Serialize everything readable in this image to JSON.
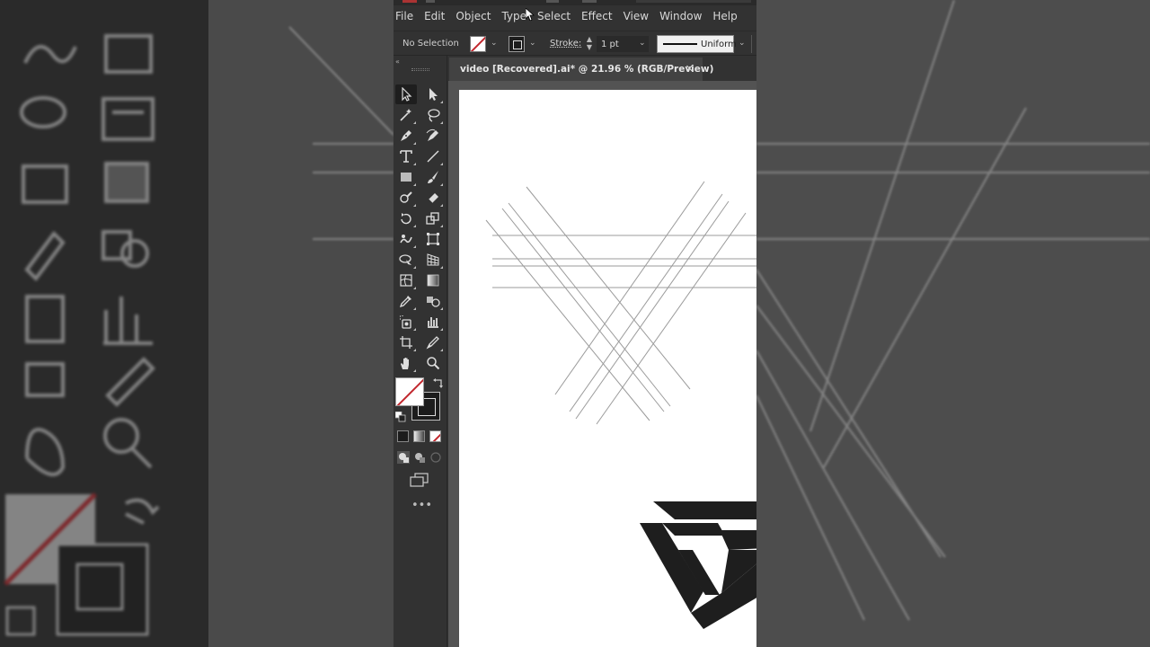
{
  "menu": {
    "items": [
      "File",
      "Edit",
      "Object",
      "Type",
      "Select",
      "Effect",
      "View",
      "Window",
      "Help"
    ]
  },
  "control_bar": {
    "selection_status": "No Selection",
    "stroke_label": "Stroke:",
    "stroke_weight": "1 pt",
    "profile": "Uniform"
  },
  "document": {
    "tab_title": "video [Recovered].ai* @ 21.96 % (RGB/Preview)",
    "close_glyph": "✕"
  },
  "toolbar": {
    "collapse_glyph": "«",
    "more_glyph": "•••"
  },
  "colors": {
    "app_bg": "#323232",
    "canvas_bg": "#535353",
    "artboard": "#ffffff",
    "none_red": "#c1272d",
    "logo": "#1e1e1e"
  },
  "icons": [
    "selection-tool-icon",
    "direct-selection-tool-icon",
    "magic-wand-tool-icon",
    "lasso-tool-icon",
    "pen-tool-icon",
    "curvature-tool-icon",
    "type-tool-icon",
    "line-segment-tool-icon",
    "rectangle-tool-icon",
    "paintbrush-tool-icon",
    "shaper-tool-icon",
    "eraser-tool-icon",
    "rotate-tool-icon",
    "scale-tool-icon",
    "warp-tool-icon",
    "free-transform-tool-icon",
    "shape-builder-tool-icon",
    "perspective-grid-tool-icon",
    "mesh-tool-icon",
    "gradient-tool-icon",
    "eyedropper-tool-icon",
    "blend-tool-icon",
    "symbol-sprayer-tool-icon",
    "column-graph-tool-icon",
    "artboard-tool-icon",
    "slice-tool-icon",
    "hand-tool-icon",
    "zoom-tool-icon"
  ]
}
